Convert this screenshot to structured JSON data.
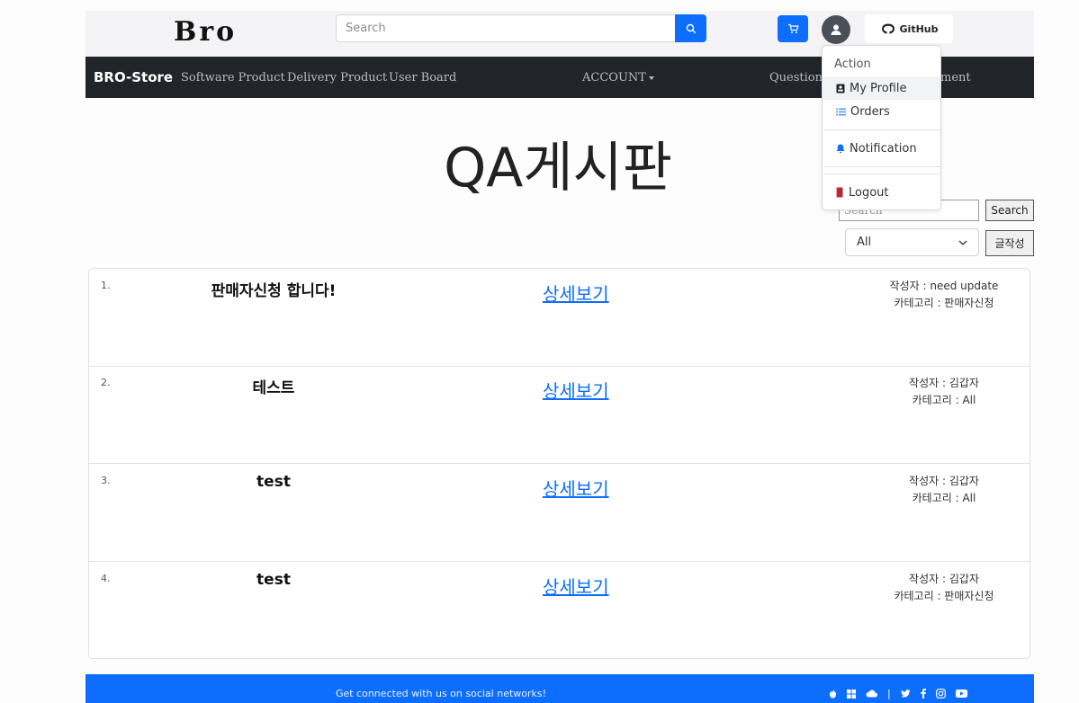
{
  "header": {
    "logo": "Bro",
    "search_placeholder": "Search",
    "github_label": "GitHub"
  },
  "nav": {
    "brand": "BRO-Store",
    "links": [
      "Software Product",
      "Delivery Product",
      "User Board"
    ],
    "account": "ACCOUNT",
    "question": "Question",
    "notice_partial": "ment"
  },
  "dropdown": {
    "header": "Action",
    "items": [
      {
        "label": "My Profile",
        "icon": "profile-icon"
      },
      {
        "label": "Orders",
        "icon": "list-icon"
      },
      {
        "label": "Notification",
        "icon": "bell-icon"
      },
      {
        "label": "Logout",
        "icon": "logout-icon"
      }
    ]
  },
  "board": {
    "title": "QA게시판",
    "search_placeholder": "Search",
    "search_button": "Search",
    "category_selected": "All",
    "write_button": "글작성",
    "posts": [
      {
        "num": "1.",
        "title": "판매자신청 합니다!",
        "link": "상세보기",
        "author": "작성자 : need update",
        "category": "카테고리 : 판매자신청"
      },
      {
        "num": "2.",
        "title": "테스트",
        "link": "상세보기",
        "author": "작성자 : 김갑자",
        "category": "카테고리 : All"
      },
      {
        "num": "3.",
        "title": "test",
        "link": "상세보기",
        "author": "작성자 : 김갑자",
        "category": "카테고리 : All"
      },
      {
        "num": "4.",
        "title": "test",
        "link": "상세보기",
        "author": "작성자 : 김갑자",
        "category": "카테고리 : 판매자신청"
      }
    ]
  },
  "footer": {
    "text": "Get connected with us on social networks!",
    "icons": [
      "apple-icon",
      "windows-icon",
      "cloud-icon",
      "twitter-icon",
      "facebook-icon",
      "instagram-icon",
      "youtube-icon"
    ]
  },
  "colors": {
    "primary": "#0d6efd",
    "navbar": "#212529",
    "topbar": "#f4f4f6"
  }
}
